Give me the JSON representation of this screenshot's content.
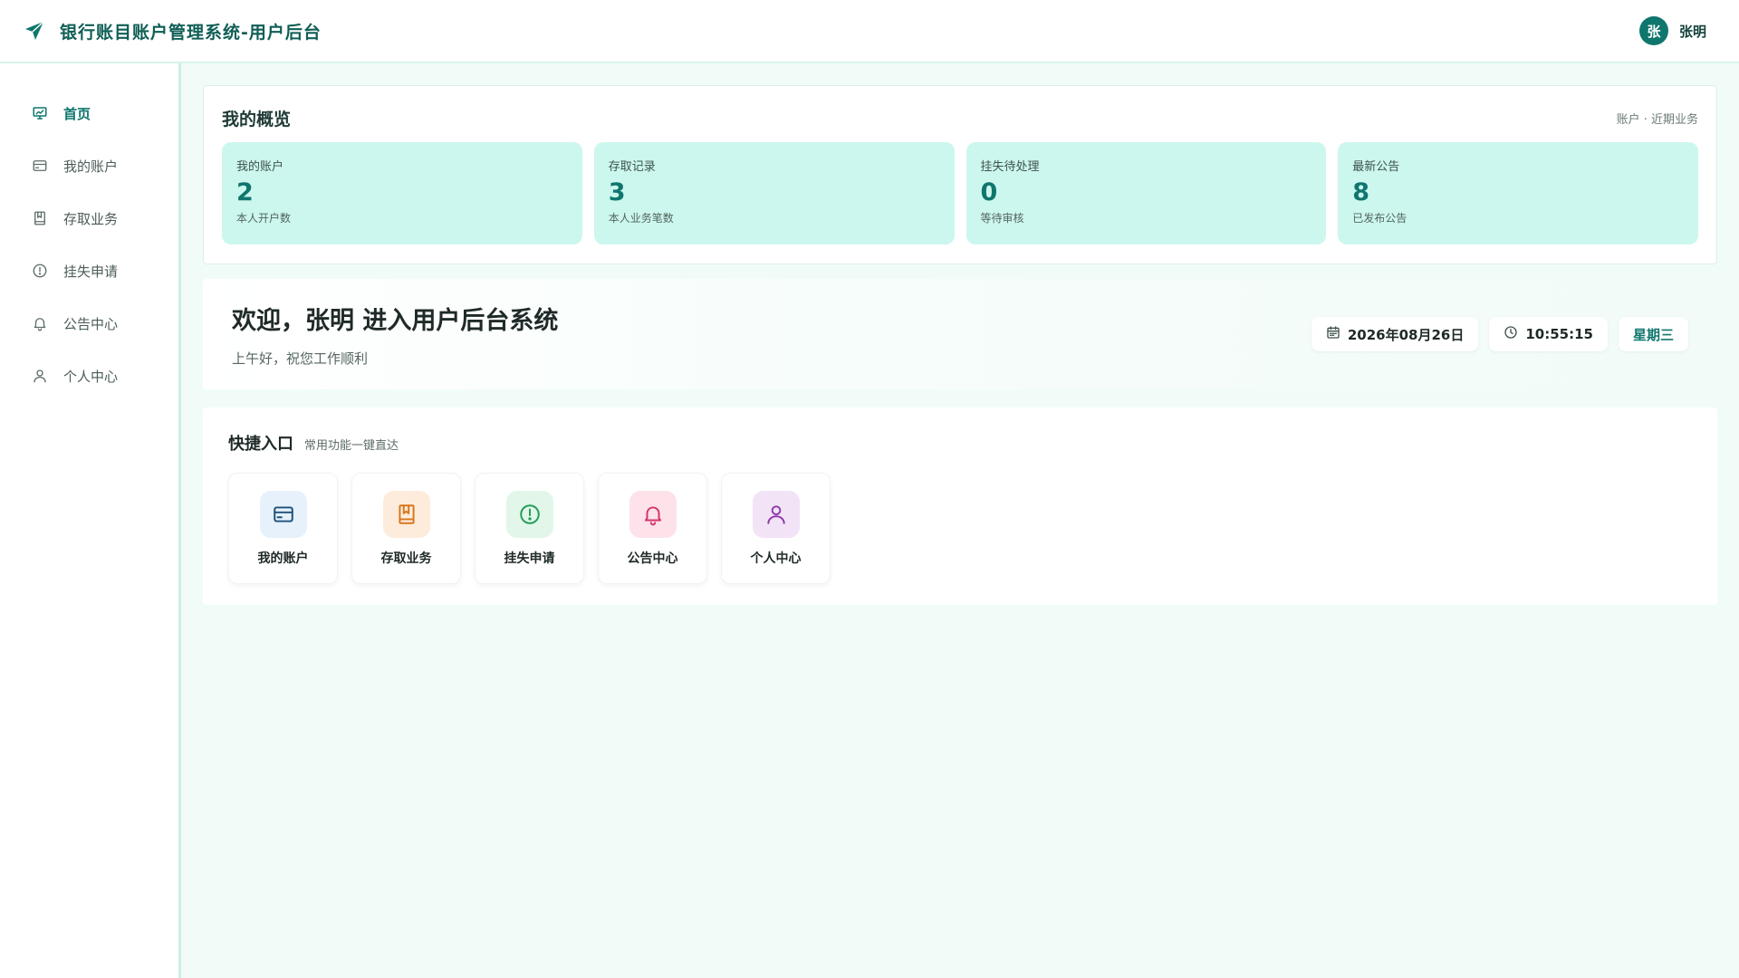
{
  "app": {
    "title": "银行账目账户管理系统-用户后台",
    "brand_icon": "paper-plane-icon",
    "accent_color": "#0f766e"
  },
  "user": {
    "avatar_text": "张",
    "name": "张明"
  },
  "sidebar": {
    "items": [
      {
        "label": "首页",
        "icon": "presentation-chart-icon",
        "active": true
      },
      {
        "label": "我的账户",
        "icon": "credit-card-icon",
        "active": false
      },
      {
        "label": "存取业务",
        "icon": "bookmark-book-icon",
        "active": false
      },
      {
        "label": "挂失申请",
        "icon": "alert-circle-icon",
        "active": false
      },
      {
        "label": "公告中心",
        "icon": "bell-icon",
        "active": false
      },
      {
        "label": "个人中心",
        "icon": "user-icon",
        "active": false
      }
    ]
  },
  "overview": {
    "title": "我的概览",
    "hint": "账户 · 近期业务",
    "cards": [
      {
        "label": "我的账户",
        "value": "2",
        "desc": "本人开户数"
      },
      {
        "label": "存取记录",
        "value": "3",
        "desc": "本人业务笔数"
      },
      {
        "label": "挂失待处理",
        "value": "0",
        "desc": "等待审核"
      },
      {
        "label": "最新公告",
        "value": "8",
        "desc": "已发布公告"
      }
    ]
  },
  "welcome": {
    "title": "欢迎，张明 进入用户后台系统",
    "subtitle": "上午好，祝您工作顺利",
    "date": "2026年08月26日",
    "time": "10:55:15",
    "weekday": "星期三"
  },
  "quick": {
    "title": "快捷入口",
    "subtitle": "常用功能一键直达",
    "tiles": [
      {
        "label": "我的账户",
        "icon": "credit-card-icon",
        "bg": "#e6f1fb",
        "color": "#1d4f7a"
      },
      {
        "label": "存取业务",
        "icon": "bookmark-book-icon",
        "bg": "#fdecdb",
        "color": "#d9761e"
      },
      {
        "label": "挂失申请",
        "icon": "alert-circle-icon",
        "bg": "#e2f6ea",
        "color": "#1f9d55"
      },
      {
        "label": "公告中心",
        "icon": "bell-icon",
        "bg": "#fde2ea",
        "color": "#d6336c"
      },
      {
        "label": "个人中心",
        "icon": "user-icon",
        "bg": "#f2e3f7",
        "color": "#8e3aa8"
      }
    ]
  }
}
